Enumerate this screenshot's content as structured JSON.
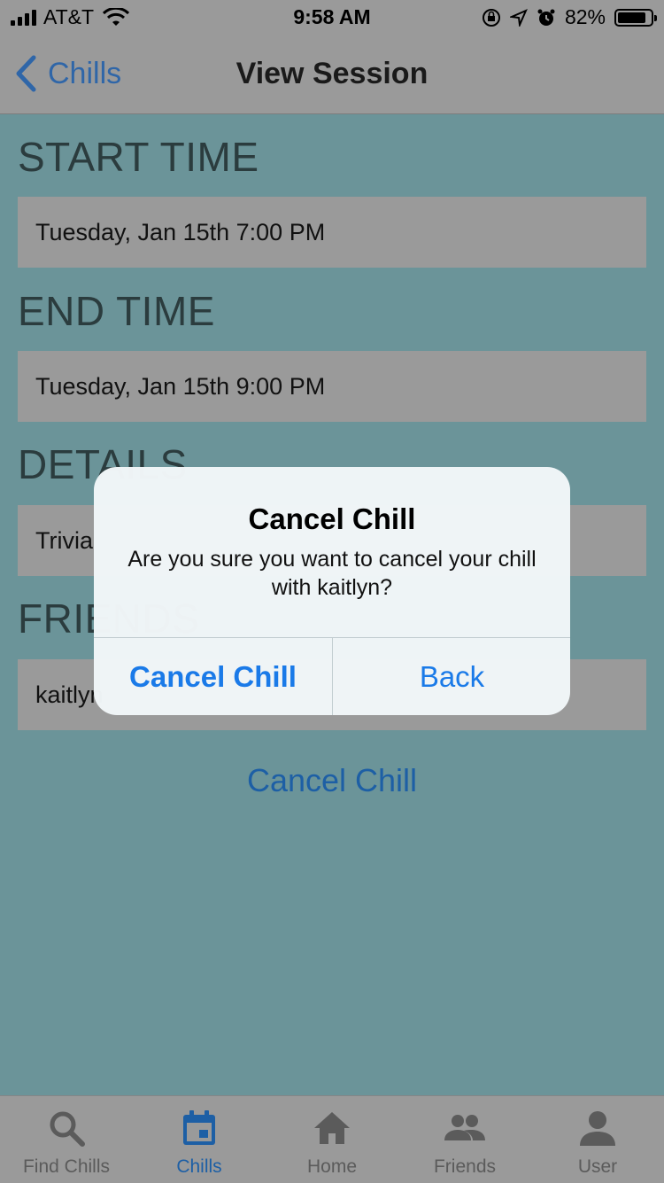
{
  "status_bar": {
    "carrier": "AT&T",
    "time": "9:58 AM",
    "battery": "82%",
    "battery_level": 0.82
  },
  "nav": {
    "back_label": "Chills",
    "title": "View Session"
  },
  "sections": {
    "start_time": {
      "label": "START TIME",
      "value": "Tuesday, Jan 15th 7:00 PM"
    },
    "end_time": {
      "label": "END TIME",
      "value": "Tuesday, Jan 15th 9:00 PM"
    },
    "details": {
      "label": "DETAILS",
      "value": "Trivia"
    },
    "friends": {
      "label": "FRIENDS",
      "value": "kaitlyn"
    }
  },
  "cancel_link": "Cancel Chill",
  "alert": {
    "title": "Cancel Chill",
    "message": "Are you sure you want to cancel your chill with kaitlyn?",
    "confirm_label": "Cancel Chill",
    "back_label": "Back"
  },
  "tabs": [
    {
      "label": "Find Chills",
      "icon": "search-icon",
      "active": false
    },
    {
      "label": "Chills",
      "icon": "calendar-icon",
      "active": true
    },
    {
      "label": "Home",
      "icon": "home-icon",
      "active": false
    },
    {
      "label": "Friends",
      "icon": "friends-icon",
      "active": false
    },
    {
      "label": "User",
      "icon": "user-icon",
      "active": false
    }
  ],
  "colors": {
    "background": "#6b9499",
    "bar": "#9a9a9a",
    "accent": "#1d5fa5",
    "alert_button": "#1a7ae8"
  }
}
